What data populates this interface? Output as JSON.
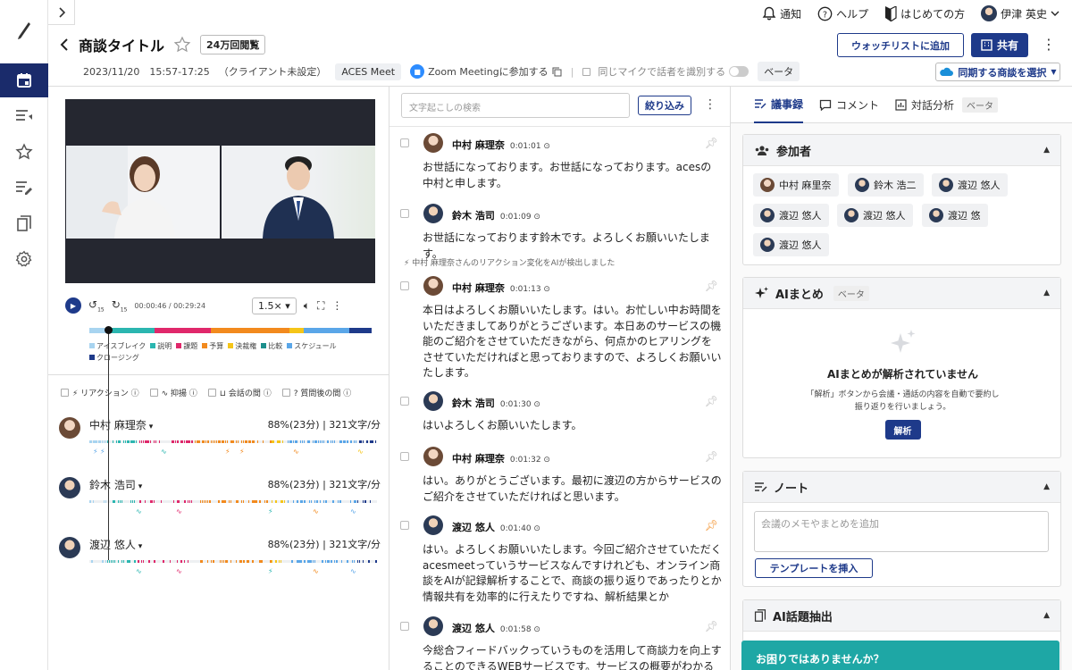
{
  "topbar": {
    "notifications": "通知",
    "help": "ヘルプ",
    "getting_started": "はじめての方",
    "user_name": "伊津 英史"
  },
  "header": {
    "title": "商談タイトル",
    "views": "24万回閲覧",
    "datetime": "2023/11/20　15:57-17:25",
    "client": "（クライアント未設定）",
    "source": "ACES Meet",
    "zoom": "Zoom Meetingに参加する",
    "same_mic": "同じマイクで話者を識別する",
    "beta": "ベータ",
    "watchlist": "ウォッチリストに追加",
    "share": "共有",
    "sync": "同期する商談を選択"
  },
  "player": {
    "time": "00:00:46 / 00:29:24",
    "speed": "1.5×",
    "skip_back": "15",
    "skip_fwd": "15"
  },
  "topics": {
    "legend": [
      {
        "label": "アイスブレイク",
        "color": "#a8d4f0"
      },
      {
        "label": "説明",
        "color": "#2bb6b0"
      },
      {
        "label": "課題",
        "color": "#e0286b"
      },
      {
        "label": "予算",
        "color": "#f28a1e"
      },
      {
        "label": "決裁権",
        "color": "#f5c518"
      },
      {
        "label": "比較",
        "color": "#1d8f8c"
      },
      {
        "label": "スケジュール",
        "color": "#5aa6e8"
      },
      {
        "label": "クロージング",
        "color": "#1e3a8a"
      }
    ]
  },
  "filters": [
    {
      "label": "リアクション"
    },
    {
      "label": "抑揚"
    },
    {
      "label": "会話の間"
    },
    {
      "label": "質問後の間"
    }
  ],
  "speakers": [
    {
      "name": "中村 麻理奈",
      "ratio": "88%(23分)",
      "speed": "321文字/分"
    },
    {
      "name": "鈴木 浩司",
      "ratio": "88%(23分)",
      "speed": "321文字/分"
    },
    {
      "name": "渡辺 悠人",
      "ratio": "88%(23分)",
      "speed": "321文字/分"
    }
  ],
  "transcript": {
    "search_placeholder": "文字起こしの検索",
    "filter_button": "絞り込み",
    "system_message": "中村 麻理奈さんのリアクション変化をAIが検出しました",
    "entries": [
      {
        "name": "中村 麻理奈",
        "time": "0:01:01",
        "text": "お世話になっております。お世話になっております。acesの中村と申します。"
      },
      {
        "name": "鈴木 浩司",
        "time": "0:01:09",
        "text": "お世話になっております鈴木です。よろしくお願いいたします。"
      },
      {
        "name": "中村 麻理奈",
        "time": "0:01:13",
        "text": "本日はよろしくお願いいたします。はい。お忙しい中お時間をいただきましてありがとうございます。本日あのサービスの機能のご紹介をさせていただきながら、何点かのヒアリングをさせていただければと思っておりますので、よろしくお願いいたします。"
      },
      {
        "name": "鈴木 浩司",
        "time": "0:01:30",
        "text": "はいよろしくお願いいたします。"
      },
      {
        "name": "中村 麻理奈",
        "time": "0:01:32",
        "text": "はい。ありがとうございます。最初に渡辺の方からサービスのご紹介をさせていただければと思います。"
      },
      {
        "name": "渡辺 悠人",
        "time": "0:01:40",
        "text": "はい。よろしくお願いいたします。今回ご紹介させていただくacesmeetっていうサービスなんですけれども、オンライン商談をAIが記録解析することで、商談の振り返りであったりとか情報共有を効率的に行えたりですね、解析結果とか"
      },
      {
        "name": "渡辺 悠人",
        "time": "0:01:58",
        "text": "今総合フィードバックっていうものを活用して商談力を向上することのできるWEBサービスです。サービスの概要がわかる動画"
      }
    ]
  },
  "right_panel": {
    "tabs": [
      {
        "label": "議事録"
      },
      {
        "label": "コメント"
      },
      {
        "label": "対話分析",
        "badge": "ベータ"
      }
    ],
    "participants_title": "参加者",
    "participants": [
      "中村 麻里奈",
      "鈴木 浩二",
      "渡辺 悠人",
      "渡辺 悠人",
      "渡辺 悠人",
      "渡辺 悠",
      "渡辺 悠人"
    ],
    "ai_summary_title": "AIまとめ",
    "ai_summary_badge": "ベータ",
    "ai_empty_title": "AIまとめが解析されていません",
    "ai_empty_desc1": "「解析」ボタンから会議・通話の内容を自動で要約し",
    "ai_empty_desc2": "振り返りを行いましょう。",
    "analyze_button": "解析",
    "note_title": "ノート",
    "note_placeholder": "会議のメモやまとめを追加",
    "template_button": "テンプレートを挿入",
    "topic_extract_title": "AI話題抽出",
    "help_banner": "お困りではありませんか？"
  }
}
